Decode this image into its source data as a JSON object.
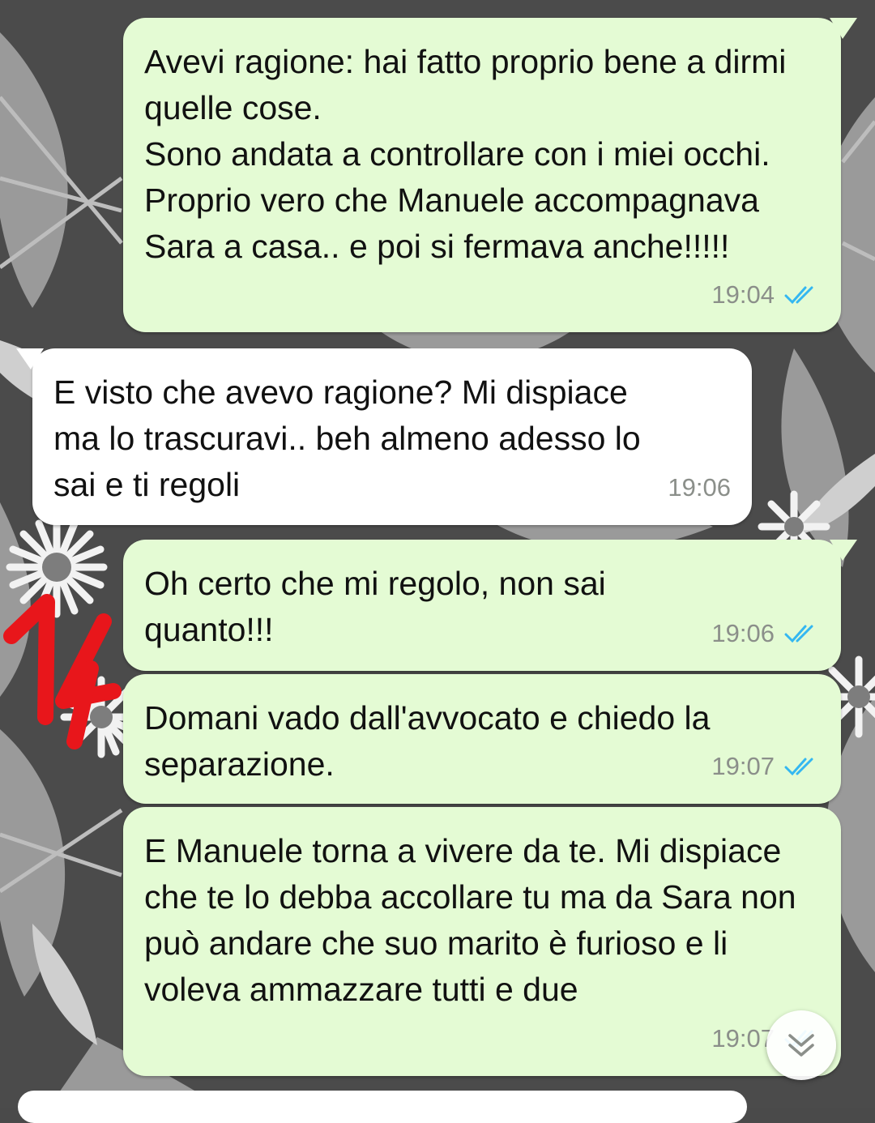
{
  "messages": [
    {
      "direction": "outgoing",
      "text": "Avevi ragione: hai fatto proprio bene a dirmi quelle cose.\nSono andata a controllare con i miei occhi. Proprio vero che Manuele accompagnava Sara a casa.. e poi si fermava anche!!!!!",
      "time": "19:04",
      "status_icon": "double-check-read"
    },
    {
      "direction": "incoming",
      "text": "E visto che avevo ragione? Mi dispiace ma lo trascuravi.. beh almeno adesso lo sai e ti regoli",
      "time": "19:06"
    },
    {
      "direction": "outgoing",
      "text": "Oh certo che mi regolo, non sai quanto!!!",
      "time": "19:06",
      "status_icon": "double-check-read"
    },
    {
      "direction": "outgoing",
      "text": "Domani vado dall'avvocato e chiedo la separazione.",
      "time": "19:07",
      "status_icon": "double-check-read"
    },
    {
      "direction": "outgoing",
      "text": "E Manuele torna a vivere da te. Mi dispiace che te lo debba accollare tu ma da Sara non può andare che suo marito è furioso e li voleva ammazzare tutti e due",
      "time": "19:07",
      "status_icon": "double-check-read"
    }
  ],
  "annotation": {
    "text": "14",
    "color": "#e8161b"
  },
  "colors": {
    "outgoing_bubble": "#e4fbd4",
    "incoming_bubble": "#ffffff",
    "read_ticks": "#34b7f1",
    "timestamp": "#8b8f8a"
  },
  "scroll_button_icon": "chevron-double-down-icon"
}
